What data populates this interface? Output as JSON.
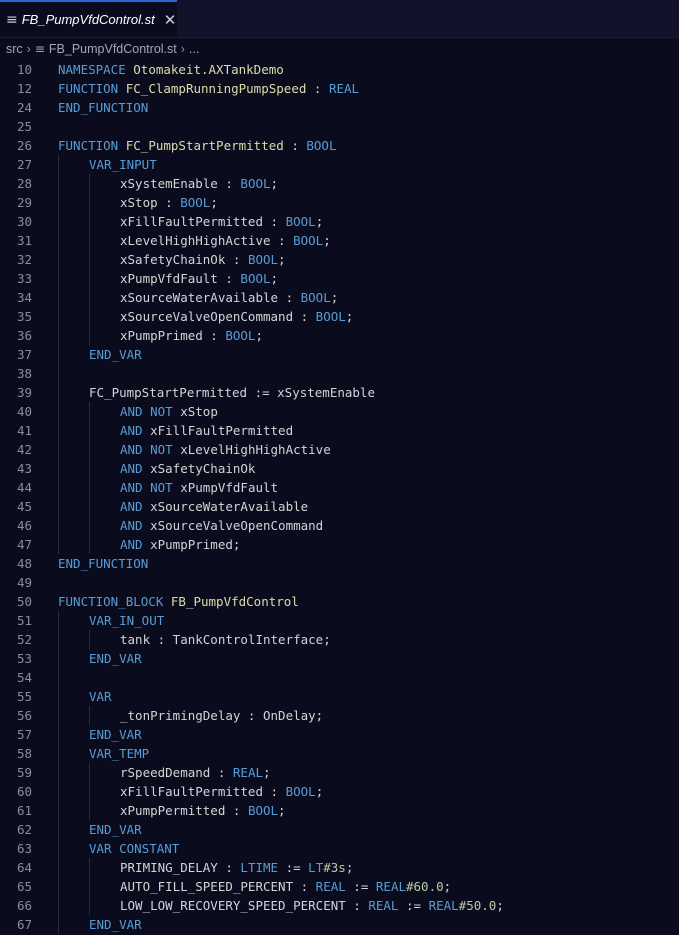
{
  "tab": {
    "icon": "≡",
    "title": "FB_PumpVfdControl.st",
    "close": "✕"
  },
  "breadcrumb": {
    "folder": "src",
    "sep1": "›",
    "file_icon": "≡",
    "file": "FB_PumpVfdControl.st",
    "sep2": "›",
    "more": "..."
  },
  "colors": {
    "keyword": "#569cd6",
    "function": "#dcdcaa",
    "identifier": "#d4d4d4",
    "number": "#b5cea8",
    "tab_accent": "#2d62d6"
  },
  "lines": [
    {
      "n": "10",
      "indent": 0,
      "tokens": [
        [
          "kw",
          "NAMESPACE"
        ],
        [
          "id",
          " "
        ],
        [
          "fn",
          "Otomakeit.AXTankDemo"
        ]
      ]
    },
    {
      "n": "12",
      "indent": 0,
      "tokens": [
        [
          "kw",
          "FUNCTION"
        ],
        [
          "id",
          " "
        ],
        [
          "fn",
          "FC_ClampRunningPumpSpeed"
        ],
        [
          "id",
          " : "
        ],
        [
          "kw",
          "REAL"
        ]
      ]
    },
    {
      "n": "24",
      "indent": 0,
      "tokens": [
        [
          "kw",
          "END_FUNCTION"
        ]
      ]
    },
    {
      "n": "25",
      "indent": 0,
      "tokens": []
    },
    {
      "n": "26",
      "indent": 0,
      "tokens": [
        [
          "kw",
          "FUNCTION"
        ],
        [
          "id",
          " "
        ],
        [
          "fn",
          "FC_PumpStartPermitted"
        ],
        [
          "id",
          " : "
        ],
        [
          "kw",
          "BOOL"
        ]
      ]
    },
    {
      "n": "27",
      "indent": 1,
      "tokens": [
        [
          "kw",
          "VAR_INPUT"
        ]
      ]
    },
    {
      "n": "28",
      "indent": 2,
      "tokens": [
        [
          "id",
          "xSystemEnable : "
        ],
        [
          "kw",
          "BOOL"
        ],
        [
          "id",
          ";"
        ]
      ]
    },
    {
      "n": "29",
      "indent": 2,
      "tokens": [
        [
          "id",
          "xStop : "
        ],
        [
          "kw",
          "BOOL"
        ],
        [
          "id",
          ";"
        ]
      ]
    },
    {
      "n": "30",
      "indent": 2,
      "tokens": [
        [
          "id",
          "xFillFaultPermitted : "
        ],
        [
          "kw",
          "BOOL"
        ],
        [
          "id",
          ";"
        ]
      ]
    },
    {
      "n": "31",
      "indent": 2,
      "tokens": [
        [
          "id",
          "xLevelHighHighActive : "
        ],
        [
          "kw",
          "BOOL"
        ],
        [
          "id",
          ";"
        ]
      ]
    },
    {
      "n": "32",
      "indent": 2,
      "tokens": [
        [
          "id",
          "xSafetyChainOk : "
        ],
        [
          "kw",
          "BOOL"
        ],
        [
          "id",
          ";"
        ]
      ]
    },
    {
      "n": "33",
      "indent": 2,
      "tokens": [
        [
          "id",
          "xPumpVfdFault : "
        ],
        [
          "kw",
          "BOOL"
        ],
        [
          "id",
          ";"
        ]
      ]
    },
    {
      "n": "34",
      "indent": 2,
      "tokens": [
        [
          "id",
          "xSourceWaterAvailable : "
        ],
        [
          "kw",
          "BOOL"
        ],
        [
          "id",
          ";"
        ]
      ]
    },
    {
      "n": "35",
      "indent": 2,
      "tokens": [
        [
          "id",
          "xSourceValveOpenCommand : "
        ],
        [
          "kw",
          "BOOL"
        ],
        [
          "id",
          ";"
        ]
      ]
    },
    {
      "n": "36",
      "indent": 2,
      "tokens": [
        [
          "id",
          "xPumpPrimed : "
        ],
        [
          "kw",
          "BOOL"
        ],
        [
          "id",
          ";"
        ]
      ]
    },
    {
      "n": "37",
      "indent": 1,
      "tokens": [
        [
          "kw",
          "END_VAR"
        ]
      ]
    },
    {
      "n": "38",
      "indent": 1,
      "tokens": []
    },
    {
      "n": "39",
      "indent": 1,
      "tokens": [
        [
          "id",
          "FC_PumpStartPermitted := xSystemEnable"
        ]
      ]
    },
    {
      "n": "40",
      "indent": 2,
      "tokens": [
        [
          "kw",
          "AND NOT"
        ],
        [
          "id",
          " xStop"
        ]
      ]
    },
    {
      "n": "41",
      "indent": 2,
      "tokens": [
        [
          "kw",
          "AND"
        ],
        [
          "id",
          " xFillFaultPermitted"
        ]
      ]
    },
    {
      "n": "42",
      "indent": 2,
      "tokens": [
        [
          "kw",
          "AND NOT"
        ],
        [
          "id",
          " xLevelHighHighActive"
        ]
      ]
    },
    {
      "n": "43",
      "indent": 2,
      "tokens": [
        [
          "kw",
          "AND"
        ],
        [
          "id",
          " xSafetyChainOk"
        ]
      ]
    },
    {
      "n": "44",
      "indent": 2,
      "tokens": [
        [
          "kw",
          "AND NOT"
        ],
        [
          "id",
          " xPumpVfdFault"
        ]
      ]
    },
    {
      "n": "45",
      "indent": 2,
      "tokens": [
        [
          "kw",
          "AND"
        ],
        [
          "id",
          " xSourceWaterAvailable"
        ]
      ]
    },
    {
      "n": "46",
      "indent": 2,
      "tokens": [
        [
          "kw",
          "AND"
        ],
        [
          "id",
          " xSourceValveOpenCommand"
        ]
      ]
    },
    {
      "n": "47",
      "indent": 2,
      "tokens": [
        [
          "kw",
          "AND"
        ],
        [
          "id",
          " xPumpPrimed;"
        ]
      ]
    },
    {
      "n": "48",
      "indent": 0,
      "tokens": [
        [
          "kw",
          "END_FUNCTION"
        ]
      ]
    },
    {
      "n": "49",
      "indent": 0,
      "tokens": []
    },
    {
      "n": "50",
      "indent": 0,
      "tokens": [
        [
          "kw",
          "FUNCTION_BLOCK"
        ],
        [
          "id",
          " "
        ],
        [
          "fn",
          "FB_PumpVfdControl"
        ]
      ]
    },
    {
      "n": "51",
      "indent": 1,
      "tokens": [
        [
          "kw",
          "VAR_IN_OUT"
        ]
      ]
    },
    {
      "n": "52",
      "indent": 2,
      "tokens": [
        [
          "id",
          "tank : TankControlInterface;"
        ]
      ]
    },
    {
      "n": "53",
      "indent": 1,
      "tokens": [
        [
          "kw",
          "END_VAR"
        ]
      ]
    },
    {
      "n": "54",
      "indent": 1,
      "tokens": []
    },
    {
      "n": "55",
      "indent": 1,
      "tokens": [
        [
          "kw",
          "VAR"
        ]
      ]
    },
    {
      "n": "56",
      "indent": 2,
      "tokens": [
        [
          "id",
          "_tonPrimingDelay : OnDelay;"
        ]
      ]
    },
    {
      "n": "57",
      "indent": 1,
      "tokens": [
        [
          "kw",
          "END_VAR"
        ]
      ]
    },
    {
      "n": "58",
      "indent": 1,
      "tokens": [
        [
          "kw",
          "VAR_TEMP"
        ]
      ]
    },
    {
      "n": "59",
      "indent": 2,
      "tokens": [
        [
          "id",
          "rSpeedDemand : "
        ],
        [
          "kw",
          "REAL"
        ],
        [
          "id",
          ";"
        ]
      ]
    },
    {
      "n": "60",
      "indent": 2,
      "tokens": [
        [
          "id",
          "xFillFaultPermitted : "
        ],
        [
          "kw",
          "BOOL"
        ],
        [
          "id",
          ";"
        ]
      ]
    },
    {
      "n": "61",
      "indent": 2,
      "tokens": [
        [
          "id",
          "xPumpPermitted : "
        ],
        [
          "kw",
          "BOOL"
        ],
        [
          "id",
          ";"
        ]
      ]
    },
    {
      "n": "62",
      "indent": 1,
      "tokens": [
        [
          "kw",
          "END_VAR"
        ]
      ]
    },
    {
      "n": "63",
      "indent": 1,
      "tokens": [
        [
          "kw",
          "VAR CONSTANT"
        ]
      ]
    },
    {
      "n": "64",
      "indent": 2,
      "tokens": [
        [
          "id",
          "PRIMING_DELAY : "
        ],
        [
          "kw",
          "LTIME"
        ],
        [
          "id",
          " := "
        ],
        [
          "kw",
          "LT"
        ],
        [
          "num",
          "#3s"
        ],
        [
          "id",
          ";"
        ]
      ]
    },
    {
      "n": "65",
      "indent": 2,
      "tokens": [
        [
          "id",
          "AUTO_FILL_SPEED_PERCENT : "
        ],
        [
          "kw",
          "REAL"
        ],
        [
          "id",
          " := "
        ],
        [
          "kw",
          "REAL"
        ],
        [
          "num",
          "#60.0"
        ],
        [
          "id",
          ";"
        ]
      ]
    },
    {
      "n": "66",
      "indent": 2,
      "tokens": [
        [
          "id",
          "LOW_LOW_RECOVERY_SPEED_PERCENT : "
        ],
        [
          "kw",
          "REAL"
        ],
        [
          "id",
          " := "
        ],
        [
          "kw",
          "REAL"
        ],
        [
          "num",
          "#50.0"
        ],
        [
          "id",
          ";"
        ]
      ]
    },
    {
      "n": "67",
      "indent": 1,
      "tokens": [
        [
          "kw",
          "END_VAR"
        ]
      ]
    }
  ]
}
